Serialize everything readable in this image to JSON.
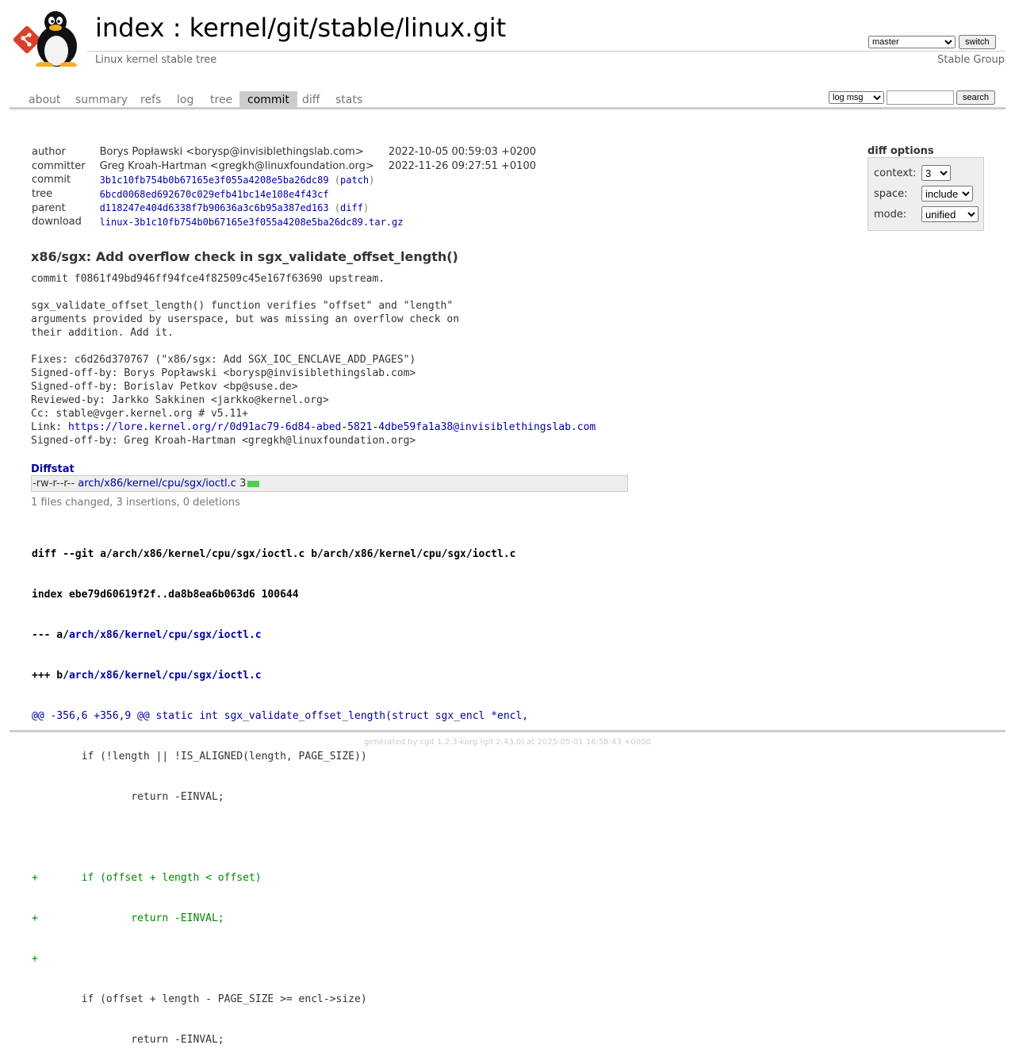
{
  "header": {
    "title_index": "index",
    "title_sep": " : ",
    "title_repo": "kernel/git/stable/linux.git",
    "subtitle": "Linux kernel stable tree",
    "owner": "Stable Group",
    "branch": "master",
    "switch_label": "switch"
  },
  "tabs": [
    "about",
    "summary",
    "refs",
    "log",
    "tree",
    "commit",
    "diff",
    "stats"
  ],
  "active_tab": "commit",
  "search": {
    "mode": "log msg",
    "value": "",
    "button": "search"
  },
  "commit_info": {
    "author_label": "author",
    "author": "Borys Popławski <borysp@invisiblethingslab.com>",
    "author_date": "2022-10-05 00:59:03 +0200",
    "committer_label": "committer",
    "committer": "Greg Kroah-Hartman <gregkh@linuxfoundation.org>",
    "committer_date": "2022-11-26 09:27:51 +0100",
    "commit_label": "commit",
    "commit": "3b1c10fb754b0b67165e3f055a4208e5ba26dc89",
    "commit_extra": "patch",
    "tree_label": "tree",
    "tree": "6bcd0068ed692670c029efb41bc14e108e4f43cf",
    "parent_label": "parent",
    "parent": "d118247e404d6338f7b90636a3c6b95a387ed163",
    "parent_extra": "diff",
    "download_label": "download",
    "download": "linux-3b1c10fb754b0b67165e3f055a4208e5ba26dc89.tar.gz",
    "open_paren": "(",
    "close_paren": ")"
  },
  "diff_options": {
    "title": "diff options",
    "context_label": "context:",
    "context_value": "3",
    "space_label": "space:",
    "space_value": "include",
    "mode_label": "mode:",
    "mode_value": "unified"
  },
  "message": {
    "subject": "x86/sgx: Add overflow check in sgx_validate_offset_length()",
    "body_before_link": "commit f0861f49bd946ff94fce4f82509c45e167f63690 upstream.\n\nsgx_validate_offset_length() function verifies \"offset\" and \"length\"\narguments provided by userspace, but was missing an overflow check on\ntheir addition. Add it.\n\nFixes: c6d26d370767 (\"x86/sgx: Add SGX_IOC_ENCLAVE_ADD_PAGES\")\nSigned-off-by: Borys Popławski <borysp@invisiblethingslab.com>\nSigned-off-by: Borislav Petkov <bp@suse.de>\nReviewed-by: Jarkko Sakkinen <jarkko@kernel.org>\nCc: stable@vger.kernel.org # v5.11+\nLink: ",
    "link": "https://lore.kernel.org/r/0d91ac79-6d84-abed-5821-4dbe59fa1a38@invisiblethingslab.com",
    "body_after_link": "\nSigned-off-by: Greg Kroah-Hartman <gregkh@linuxfoundation.org>"
  },
  "diffstat": {
    "title": "Diffstat",
    "mode": "-rw-r--r--",
    "file": "arch/x86/kernel/cpu/sgx/ioctl.c",
    "count": "3",
    "summary": "1 files changed, 3 insertions, 0 deletions"
  },
  "diff": {
    "header1": "diff --git a/arch/x86/kernel/cpu/sgx/ioctl.c b/arch/x86/kernel/cpu/sgx/ioctl.c",
    "header2": "index ebe79d60619f2f..da8b8ea6b063d6 100644",
    "old_prefix": "--- a/",
    "new_prefix": "+++ b/",
    "file": "arch/x86/kernel/cpu/sgx/ioctl.c",
    "hunk": "@@ -356,6 +356,9 @@ static int sgx_validate_offset_length(struct sgx_encl *encl,",
    "lines": [
      {
        "type": "ctx",
        "text": " \tif (!length || !IS_ALIGNED(length, PAGE_SIZE))"
      },
      {
        "type": "ctx",
        "text": " \t\treturn -EINVAL;"
      },
      {
        "type": "ctx",
        "text": " "
      },
      {
        "type": "add",
        "text": "+\tif (offset + length < offset)"
      },
      {
        "type": "add",
        "text": "+\t\treturn -EINVAL;"
      },
      {
        "type": "add",
        "text": "+"
      },
      {
        "type": "ctx",
        "text": " \tif (offset + length - PAGE_SIZE >= encl->size)"
      },
      {
        "type": "ctx",
        "text": " \t\treturn -EINVAL;"
      }
    ]
  },
  "footer": {
    "prefix": "generated by ",
    "cgit": "cgit 1.2.3-korg",
    "git": " (git 2.43.0) at 2025-05-01 16:58:43 +0000"
  },
  "colors": {
    "link": "#0000aa",
    "added": "#008800",
    "hunk": "#000099",
    "graph_add": "#55cc55",
    "tab_active_bg": "#cccccc"
  },
  "icons": {
    "logo": "git-tux-logo-icon"
  }
}
